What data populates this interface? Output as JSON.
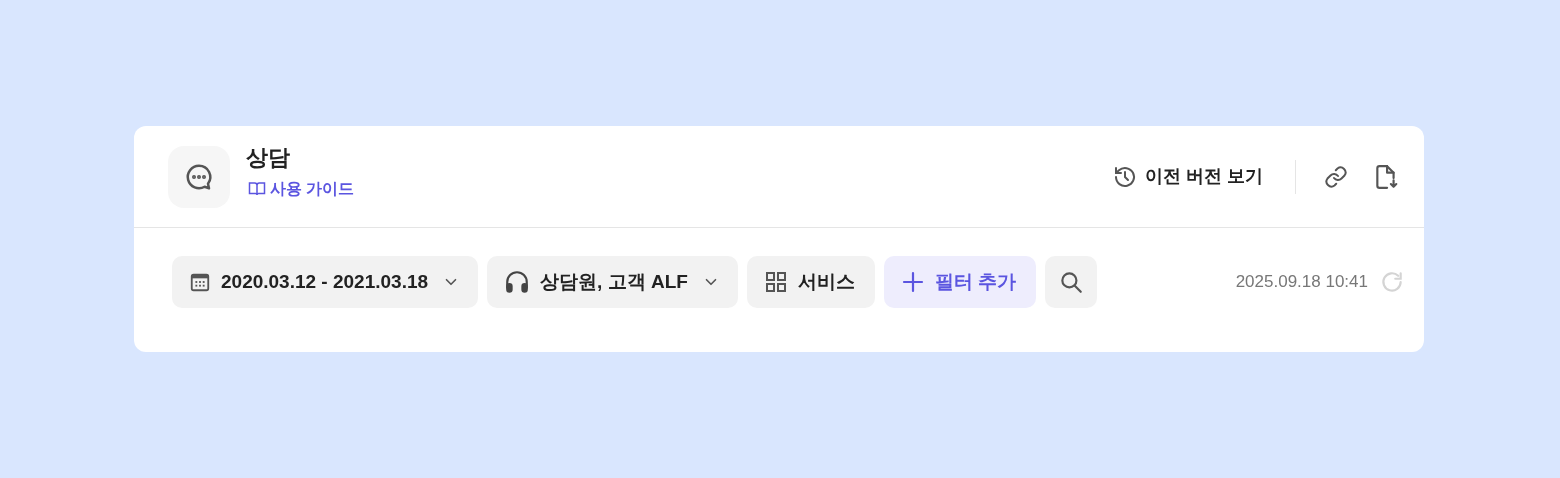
{
  "header": {
    "title": "상담",
    "guide_link": "사용 가이드",
    "history_button": "이전 버전 보기"
  },
  "filters": [
    {
      "kind": "dropdown",
      "label": "2020.03.12 - 2021.03.18"
    },
    {
      "kind": "dropdown",
      "label": "상담원, 고객 ALF"
    },
    {
      "kind": "plain",
      "label": "서비스"
    },
    {
      "kind": "add",
      "label": "필터 추가"
    }
  ],
  "updated_at": "2025.09.18 10:41"
}
